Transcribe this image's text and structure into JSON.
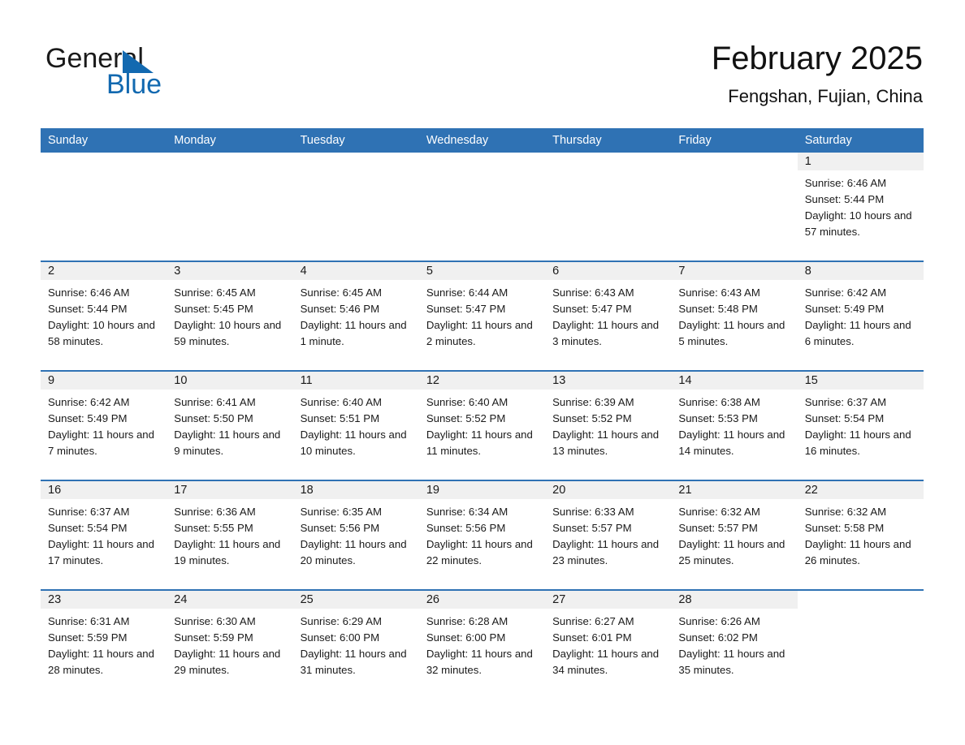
{
  "brand": {
    "name_part1": "General",
    "name_part2": "Blue",
    "accent_color": "#1269b0"
  },
  "header": {
    "title": "February 2025",
    "subtitle": "Fengshan, Fujian, China"
  },
  "theme": {
    "header_blue": "#2f72b4",
    "day_band_gray": "#f0f0f0"
  },
  "weekdays": [
    "Sunday",
    "Monday",
    "Tuesday",
    "Wednesday",
    "Thursday",
    "Friday",
    "Saturday"
  ],
  "weeks": [
    [
      {
        "day": "",
        "blank": true,
        "sunrise": "",
        "sunset": "",
        "daylight": ""
      },
      {
        "day": "",
        "blank": true,
        "sunrise": "",
        "sunset": "",
        "daylight": ""
      },
      {
        "day": "",
        "blank": true,
        "sunrise": "",
        "sunset": "",
        "daylight": ""
      },
      {
        "day": "",
        "blank": true,
        "sunrise": "",
        "sunset": "",
        "daylight": ""
      },
      {
        "day": "",
        "blank": true,
        "sunrise": "",
        "sunset": "",
        "daylight": ""
      },
      {
        "day": "",
        "blank": true,
        "sunrise": "",
        "sunset": "",
        "daylight": ""
      },
      {
        "day": "1",
        "sunrise": "Sunrise: 6:46 AM",
        "sunset": "Sunset: 5:44 PM",
        "daylight": "Daylight: 10 hours and 57 minutes."
      }
    ],
    [
      {
        "day": "2",
        "sunrise": "Sunrise: 6:46 AM",
        "sunset": "Sunset: 5:44 PM",
        "daylight": "Daylight: 10 hours and 58 minutes."
      },
      {
        "day": "3",
        "sunrise": "Sunrise: 6:45 AM",
        "sunset": "Sunset: 5:45 PM",
        "daylight": "Daylight: 10 hours and 59 minutes."
      },
      {
        "day": "4",
        "sunrise": "Sunrise: 6:45 AM",
        "sunset": "Sunset: 5:46 PM",
        "daylight": "Daylight: 11 hours and 1 minute."
      },
      {
        "day": "5",
        "sunrise": "Sunrise: 6:44 AM",
        "sunset": "Sunset: 5:47 PM",
        "daylight": "Daylight: 11 hours and 2 minutes."
      },
      {
        "day": "6",
        "sunrise": "Sunrise: 6:43 AM",
        "sunset": "Sunset: 5:47 PM",
        "daylight": "Daylight: 11 hours and 3 minutes."
      },
      {
        "day": "7",
        "sunrise": "Sunrise: 6:43 AM",
        "sunset": "Sunset: 5:48 PM",
        "daylight": "Daylight: 11 hours and 5 minutes."
      },
      {
        "day": "8",
        "sunrise": "Sunrise: 6:42 AM",
        "sunset": "Sunset: 5:49 PM",
        "daylight": "Daylight: 11 hours and 6 minutes."
      }
    ],
    [
      {
        "day": "9",
        "sunrise": "Sunrise: 6:42 AM",
        "sunset": "Sunset: 5:49 PM",
        "daylight": "Daylight: 11 hours and 7 minutes."
      },
      {
        "day": "10",
        "sunrise": "Sunrise: 6:41 AM",
        "sunset": "Sunset: 5:50 PM",
        "daylight": "Daylight: 11 hours and 9 minutes."
      },
      {
        "day": "11",
        "sunrise": "Sunrise: 6:40 AM",
        "sunset": "Sunset: 5:51 PM",
        "daylight": "Daylight: 11 hours and 10 minutes."
      },
      {
        "day": "12",
        "sunrise": "Sunrise: 6:40 AM",
        "sunset": "Sunset: 5:52 PM",
        "daylight": "Daylight: 11 hours and 11 minutes."
      },
      {
        "day": "13",
        "sunrise": "Sunrise: 6:39 AM",
        "sunset": "Sunset: 5:52 PM",
        "daylight": "Daylight: 11 hours and 13 minutes."
      },
      {
        "day": "14",
        "sunrise": "Sunrise: 6:38 AM",
        "sunset": "Sunset: 5:53 PM",
        "daylight": "Daylight: 11 hours and 14 minutes."
      },
      {
        "day": "15",
        "sunrise": "Sunrise: 6:37 AM",
        "sunset": "Sunset: 5:54 PM",
        "daylight": "Daylight: 11 hours and 16 minutes."
      }
    ],
    [
      {
        "day": "16",
        "sunrise": "Sunrise: 6:37 AM",
        "sunset": "Sunset: 5:54 PM",
        "daylight": "Daylight: 11 hours and 17 minutes."
      },
      {
        "day": "17",
        "sunrise": "Sunrise: 6:36 AM",
        "sunset": "Sunset: 5:55 PM",
        "daylight": "Daylight: 11 hours and 19 minutes."
      },
      {
        "day": "18",
        "sunrise": "Sunrise: 6:35 AM",
        "sunset": "Sunset: 5:56 PM",
        "daylight": "Daylight: 11 hours and 20 minutes."
      },
      {
        "day": "19",
        "sunrise": "Sunrise: 6:34 AM",
        "sunset": "Sunset: 5:56 PM",
        "daylight": "Daylight: 11 hours and 22 minutes."
      },
      {
        "day": "20",
        "sunrise": "Sunrise: 6:33 AM",
        "sunset": "Sunset: 5:57 PM",
        "daylight": "Daylight: 11 hours and 23 minutes."
      },
      {
        "day": "21",
        "sunrise": "Sunrise: 6:32 AM",
        "sunset": "Sunset: 5:57 PM",
        "daylight": "Daylight: 11 hours and 25 minutes."
      },
      {
        "day": "22",
        "sunrise": "Sunrise: 6:32 AM",
        "sunset": "Sunset: 5:58 PM",
        "daylight": "Daylight: 11 hours and 26 minutes."
      }
    ],
    [
      {
        "day": "23",
        "sunrise": "Sunrise: 6:31 AM",
        "sunset": "Sunset: 5:59 PM",
        "daylight": "Daylight: 11 hours and 28 minutes."
      },
      {
        "day": "24",
        "sunrise": "Sunrise: 6:30 AM",
        "sunset": "Sunset: 5:59 PM",
        "daylight": "Daylight: 11 hours and 29 minutes."
      },
      {
        "day": "25",
        "sunrise": "Sunrise: 6:29 AM",
        "sunset": "Sunset: 6:00 PM",
        "daylight": "Daylight: 11 hours and 31 minutes."
      },
      {
        "day": "26",
        "sunrise": "Sunrise: 6:28 AM",
        "sunset": "Sunset: 6:00 PM",
        "daylight": "Daylight: 11 hours and 32 minutes."
      },
      {
        "day": "27",
        "sunrise": "Sunrise: 6:27 AM",
        "sunset": "Sunset: 6:01 PM",
        "daylight": "Daylight: 11 hours and 34 minutes."
      },
      {
        "day": "28",
        "sunrise": "Sunrise: 6:26 AM",
        "sunset": "Sunset: 6:02 PM",
        "daylight": "Daylight: 11 hours and 35 minutes."
      },
      {
        "day": "",
        "blank": true,
        "sunrise": "",
        "sunset": "",
        "daylight": ""
      }
    ]
  ]
}
